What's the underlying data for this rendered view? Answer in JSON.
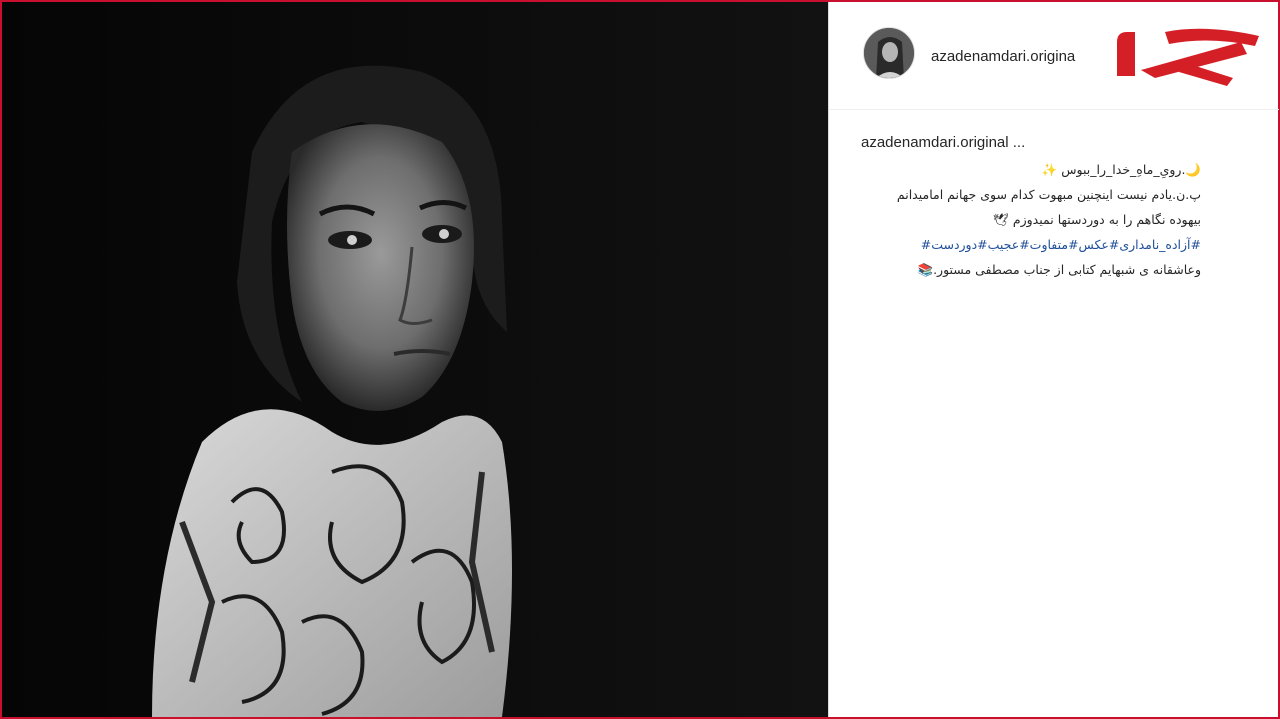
{
  "post": {
    "username": "azadenamdari.origina",
    "caption_username": "azadenamdari.original ...",
    "caption_lines": [
      "🌙.رویِ_ماهِ_خدا_را_ببوس ✨",
      "پ.ن.یادم نیست اینچنین مبهوت کدام سوی جهانم امامیدانم",
      "بیهوده نگاهم را به دوردستها نمیدوزم 🕊",
      "#آزاده_نامداری#عکس#متفاوت#عجیب#دوردست#",
      "وعاشقانه ی شبهایم کتابی از جناب مصطفی مستور.📚"
    ]
  },
  "brand": {
    "logo_name": "rokna-logo",
    "color": "#c8102e"
  },
  "icons": [
    "avatar-photo"
  ]
}
